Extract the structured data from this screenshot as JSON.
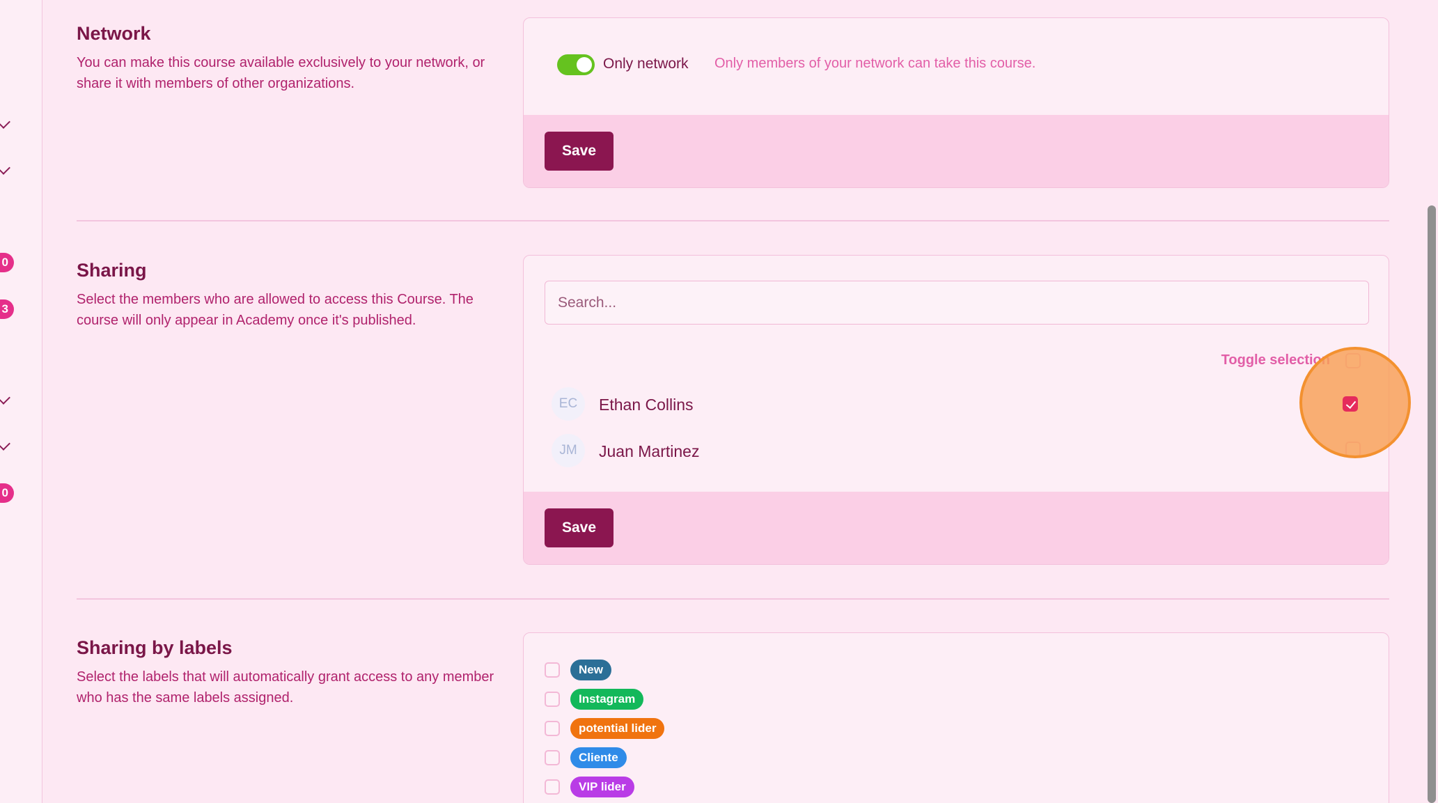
{
  "network": {
    "title": "Network",
    "description": "You can make this course available exclusively to your network, or share it with members of other organizations.",
    "toggle_label": "Only network",
    "toggle_on": true,
    "hint": "Only members of your network can take this course.",
    "save_label": "Save"
  },
  "sharing": {
    "title": "Sharing",
    "description": "Select the members who are allowed to access this Course. The course will only appear in Academy once it's published.",
    "search_placeholder": "Search...",
    "toggle_selection_label": "Toggle selection",
    "members": [
      {
        "initials": "EC",
        "name": "Ethan Collins",
        "checked": true
      },
      {
        "initials": "JM",
        "name": "Juan Martinez",
        "checked": false
      }
    ],
    "save_label": "Save"
  },
  "labels": {
    "title": "Sharing by labels",
    "description": "Select the labels that will automatically grant access to any member who has the same labels assigned.",
    "items": [
      {
        "name": "New",
        "color": "#2b6f97"
      },
      {
        "name": "Instagram",
        "color": "#13b85a"
      },
      {
        "name": "potential lider",
        "color": "#f0730f"
      },
      {
        "name": "Cliente",
        "color": "#2f8be8"
      },
      {
        "name": "VIP lider",
        "color": "#b93ce6"
      }
    ]
  },
  "sidebar": {
    "badges": [
      "0",
      "3",
      "0"
    ]
  },
  "colors": {
    "accent": "#8b1650",
    "toggle_on": "#65c21f",
    "checkbox_checked": "#e52c5c"
  }
}
